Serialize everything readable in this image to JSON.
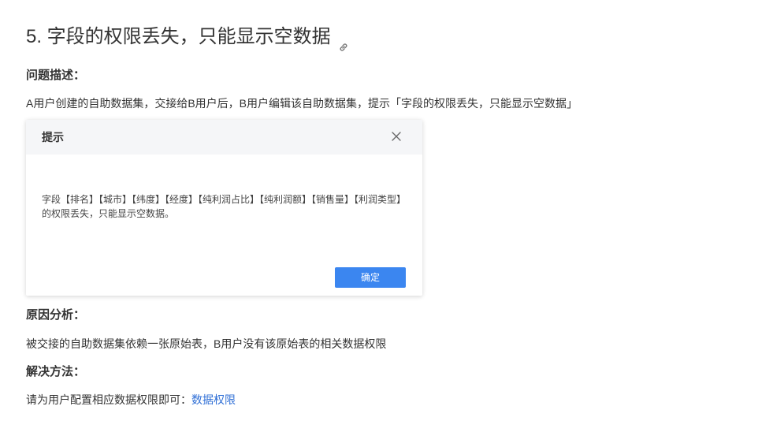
{
  "heading": {
    "title": "5. 字段的权限丢失，只能显示空数据",
    "anchor_icon": "link-icon"
  },
  "problem": {
    "label": "问题描述：",
    "text": "A用户创建的自助数据集，交接给B用户后，B用户编辑该自助数据集，提示「字段的权限丢失，只能显示空数据」"
  },
  "dialog": {
    "title": "提示",
    "close_icon": "close-icon",
    "message": "字段【排名】【城市】【纬度】【经度】【纯利润占比】【纯利润额】【销售量】【利润类型】的权限丢失，只能显示空数据。",
    "ok_label": "确定",
    "ok_color": "#3b86f0"
  },
  "cause": {
    "label": "原因分析：",
    "text": "被交接的自助数据集依赖一张原始表，B用户没有该原始表的相关数据权限"
  },
  "solution": {
    "label": "解决方法：",
    "text": "请为用户配置相应数据权限即可：",
    "link_text": "数据权限",
    "link_color": "#2f6fd6"
  }
}
